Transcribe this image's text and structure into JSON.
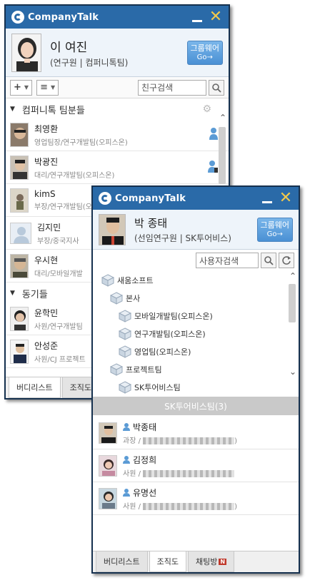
{
  "back_window": {
    "app_title": "CompanyTalk",
    "profile": {
      "name": "이 여진",
      "sub": "(연구원 | 컴퍼니톡팀)"
    },
    "groupware": {
      "label": "그룹웨어",
      "go": "Go→"
    },
    "toolbar": {
      "add": "+",
      "list": "≡",
      "search_value": "친구검색"
    },
    "groups": [
      {
        "name": "컴퍼니톡 팀분들",
        "members": [
          {
            "name": "최영환",
            "sub": "영업팀장/연구개발팀(오피스온)"
          },
          {
            "name": "박광진",
            "sub": "대리/연구개발팀(오피스온)"
          },
          {
            "name": "kimS",
            "sub": "부장/연구개발팀(오피스온)"
          },
          {
            "name": "김지민",
            "sub": "부장/중국지사"
          },
          {
            "name": "우시현",
            "sub": "대리/모바일개발"
          }
        ]
      },
      {
        "name": "동기들",
        "members": [
          {
            "name": "윤학민",
            "sub": "사원/연구개발팀"
          },
          {
            "name": "안성준",
            "sub": "사원/CJ 프로젝트"
          }
        ]
      }
    ],
    "tabs": [
      "버디리스트",
      "조직도"
    ]
  },
  "front_window": {
    "app_title": "CompanyTalk",
    "profile": {
      "name": "박 종태",
      "sub": "(선임연구원 | SK투어비스)"
    },
    "groupware": {
      "label": "그룹웨어",
      "go": "Go→"
    },
    "search_value": "사용자검색",
    "tree": [
      {
        "label": "새움소프트",
        "level": 0
      },
      {
        "label": "본사",
        "level": 1
      },
      {
        "label": "모바일개발팀(오피스온)",
        "level": 2
      },
      {
        "label": "연구개발팀(오피스온)",
        "level": 2
      },
      {
        "label": "영업팀(오피스온)",
        "level": 2
      },
      {
        "label": "프로젝트팀",
        "level": 1
      },
      {
        "label": "SK투어비스팀",
        "level": 2
      }
    ],
    "section_title": "SK투어비스팀(3)",
    "members": [
      {
        "name": "박종태",
        "role": "과장 / ",
        "tail": ")"
      },
      {
        "name": "김정희",
        "role": "사원 / ",
        "tail": ""
      },
      {
        "name": "유명선",
        "role": "사원 / ",
        "tail": ")"
      }
    ],
    "tabs": [
      "버디리스트",
      "조직도",
      "채팅방"
    ],
    "tab_badge": "N"
  },
  "colors": {
    "titlebar": "#2a6aa8",
    "accent_blue": "#4a90d4",
    "close": "#f2c94c"
  }
}
